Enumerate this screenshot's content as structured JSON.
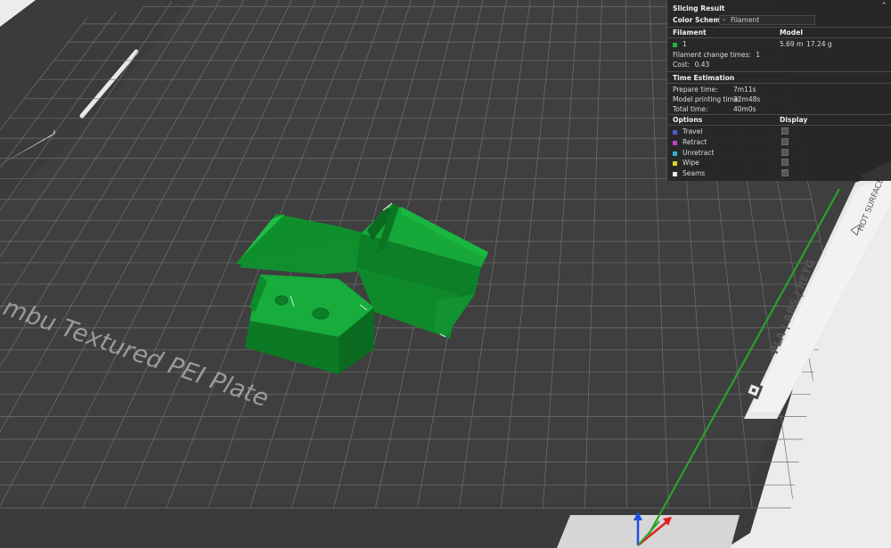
{
  "plate": {
    "label": "mbu Textured PEI Plate",
    "badge_materials": "PLA | ABS | PETG",
    "badge_warning": "HOT SURFACE"
  },
  "colors": {
    "model_green": "#14a535",
    "plate_dark": "#3a3a3a",
    "axis_x": "#e02020",
    "axis_y": "#2aa12a",
    "axis_z": "#2050e0"
  },
  "panel": {
    "title": "Slicing Result",
    "collapse_icon": "chevron-up-icon",
    "color_scheme_label": "Color Scheme",
    "color_scheme_value": "Filament",
    "filament_header": "Filament",
    "model_header": "Model",
    "filament_id": "1",
    "filament_color": "#22b14c",
    "filament_length": "5.69 m",
    "filament_weight": "17.24 g",
    "change_times_label": "Filament change times:",
    "change_times_value": "1",
    "cost_label": "Cost:",
    "cost_value": "0.43",
    "time_header": "Time Estimation",
    "prepare_label": "Prepare time:",
    "prepare_value": "7m11s",
    "model_print_label": "Model printing time:",
    "model_print_value": "32m48s",
    "total_label": "Total time:",
    "total_value": "40m0s",
    "options_header": "Options",
    "display_header": "Display",
    "options": [
      {
        "label": "Travel",
        "color": "#4a5fd0",
        "checked": false
      },
      {
        "label": "Retract",
        "color": "#c040c0",
        "checked": false
      },
      {
        "label": "Unretract",
        "color": "#30b0d0",
        "checked": false
      },
      {
        "label": "Wipe",
        "color": "#e0d020",
        "checked": false
      },
      {
        "label": "Seams",
        "color": "#e8e8e8",
        "checked": true
      }
    ]
  }
}
